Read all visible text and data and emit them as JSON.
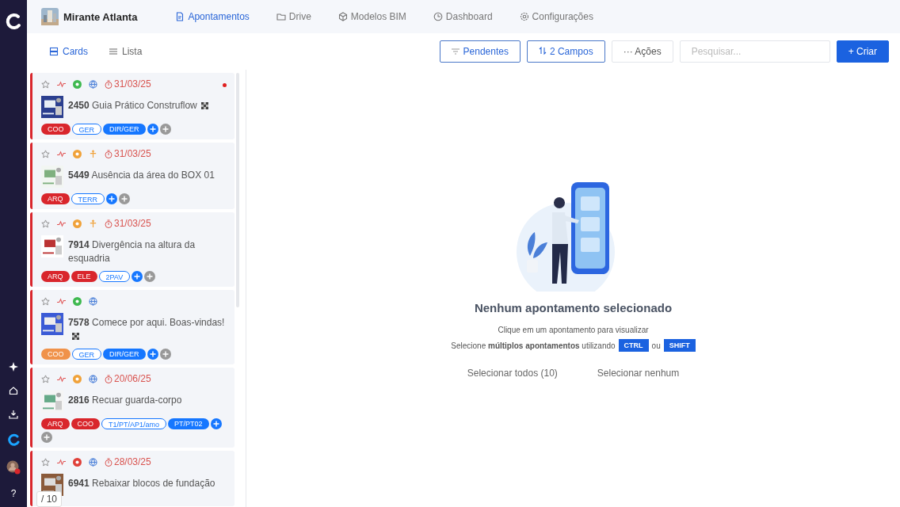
{
  "project": {
    "name": "Mirante Atlanta"
  },
  "nav_tabs": [
    {
      "label": "Apontamentos",
      "selected": true
    },
    {
      "label": "Drive",
      "selected": false
    },
    {
      "label": "Modelos BIM",
      "selected": false
    },
    {
      "label": "Dashboard",
      "selected": false
    },
    {
      "label": "Configurações",
      "selected": false
    }
  ],
  "view_toggle": [
    {
      "label": "Cards",
      "selected": true
    },
    {
      "label": "Lista",
      "selected": false
    }
  ],
  "toolbar": {
    "filter_button": {
      "label": "Pendentes",
      "active": true
    },
    "sort_button": {
      "label": "2 Campos",
      "active": true
    },
    "actions_button": {
      "label": "··· Ações"
    },
    "search": {
      "placeholder": "Pesquisar..."
    },
    "create_button": {
      "label": "+ Criar"
    }
  },
  "cards": [
    {
      "number": "2450",
      "title": "Guia Prático Construflow",
      "flag": true,
      "color": "#3fb950",
      "kind": "globe",
      "date": "31/03/25",
      "unread": true,
      "tags": [
        {
          "label": "COO",
          "kind": "filled",
          "color": "#d9262c"
        },
        {
          "label": "GER",
          "kind": "outline",
          "color": "#1677ff"
        },
        {
          "label": "DIR/GER",
          "kind": "filled",
          "color": "#1677ff"
        }
      ]
    },
    {
      "number": "5449",
      "title": "Ausência da área do BOX 01",
      "flag": false,
      "color": "#f0a23a",
      "kind": "move",
      "date": "31/03/25",
      "unread": false,
      "tags": [
        {
          "label": "ARQ",
          "kind": "filled",
          "color": "#d9262c"
        },
        {
          "label": "TERR",
          "kind": "outline",
          "color": "#1677ff"
        }
      ]
    },
    {
      "number": "7914",
      "title": "Divergência na altura da esquadria",
      "flag": false,
      "color": "#f0a23a",
      "kind": "move",
      "date": "31/03/25",
      "unread": false,
      "tags": [
        {
          "label": "ARQ",
          "kind": "filled",
          "color": "#d9262c"
        },
        {
          "label": "ELE",
          "kind": "filled",
          "color": "#d9262c"
        },
        {
          "label": "2PAV",
          "kind": "outline",
          "color": "#1677ff"
        }
      ]
    },
    {
      "number": "7578",
      "title": "Comece por aqui. Boas-vindas!",
      "flag": true,
      "color": "#3fb950",
      "kind": "globe",
      "unread": false,
      "tags": [
        {
          "label": "COO",
          "kind": "filled",
          "color": "#f0924a"
        },
        {
          "label": "GER",
          "kind": "outline",
          "color": "#1677ff"
        },
        {
          "label": "DIR/GER",
          "kind": "filled",
          "color": "#1677ff"
        }
      ]
    },
    {
      "number": "2816",
      "title": "Recuar guarda-corpo",
      "flag": false,
      "color": "#f0a23a",
      "kind": "globe",
      "date": "20/06/25",
      "unread": false,
      "tags": [
        {
          "label": "ARQ",
          "kind": "filled",
          "color": "#d9262c"
        },
        {
          "label": "COO",
          "kind": "filled",
          "color": "#d9262c"
        },
        {
          "label": "T1/PT/AP1/amo",
          "kind": "outline",
          "color": "#1677ff"
        },
        {
          "label": "PT/PT02",
          "kind": "filled",
          "color": "#1677ff"
        }
      ]
    },
    {
      "number": "6941",
      "title": "Rebaixar blocos de fundação",
      "flag": false,
      "color": "#e0413a",
      "kind": "globe",
      "date": "28/03/25",
      "unread": false
    }
  ],
  "pager": {
    "total": "/ 10"
  },
  "empty_state": {
    "title": "Nenhum apontamento selecionado",
    "hint": "Clique em um apontamento para visualizar",
    "multi_hint": "Selecione **múltiplos apontamentos** utilizando",
    "key_1": "CTRL",
    "joiner": "ou",
    "key_2": "SHIFT",
    "select_all": "Selecionar todos (10)",
    "select_none": "Selecionar nenhum"
  },
  "sidebar": {
    "help_label": "?"
  }
}
